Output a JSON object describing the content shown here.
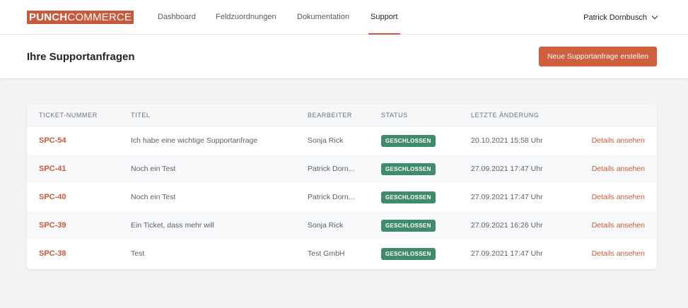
{
  "brand": {
    "logo_bold": "PUNCH",
    "logo_light": "COMMERCE",
    "accent_color": "#c8593a"
  },
  "nav": {
    "items": [
      {
        "label": "Dashboard",
        "active": false
      },
      {
        "label": "Feldzuordnungen",
        "active": false
      },
      {
        "label": "Dokumentation",
        "active": false
      },
      {
        "label": "Support",
        "active": true
      }
    ],
    "user_name": "Patrick Dornbusch",
    "user_menu_icon": "chevron-down-icon"
  },
  "header": {
    "title": "Ihre Supportanfragen",
    "create_button_label": "Neue Supportanfrage erstellen"
  },
  "table": {
    "columns": [
      "Ticket-Nummer",
      "Titel",
      "Bearbeiter",
      "Status",
      "Letzte Änderung"
    ],
    "rows": [
      {
        "ticket": "SPC-54",
        "title": "Ich habe eine wichtige Supportanfrage",
        "assignee": "Sonja Rick",
        "status": "GESCHLOSSEN",
        "updated": "20.10.2021 15:58 Uhr",
        "action": "Details ansehen"
      },
      {
        "ticket": "SPC-41",
        "title": "Noch ein Test",
        "assignee": "Patrick Dorn...",
        "status": "GESCHLOSSEN",
        "updated": "27.09.2021 17:47 Uhr",
        "action": "Details ansehen"
      },
      {
        "ticket": "SPC-40",
        "title": "Noch ein Test",
        "assignee": "Patrick Dorn...",
        "status": "GESCHLOSSEN",
        "updated": "27.09.2021 17:47 Uhr",
        "action": "Details ansehen"
      },
      {
        "ticket": "SPC-39",
        "title": "Ein Ticket, dass mehr will",
        "assignee": "Sonja Rick",
        "status": "GESCHLOSSEN",
        "updated": "27.09.2021 16:26 Uhr",
        "action": "Details ansehen"
      },
      {
        "ticket": "SPC-38",
        "title": "Test",
        "assignee": "Test GmbH",
        "status": "GESCHLOSSEN",
        "updated": "27.09.2021 17:47 Uhr",
        "action": "Details ansehen"
      }
    ],
    "status_color": "#3f8c6c"
  }
}
